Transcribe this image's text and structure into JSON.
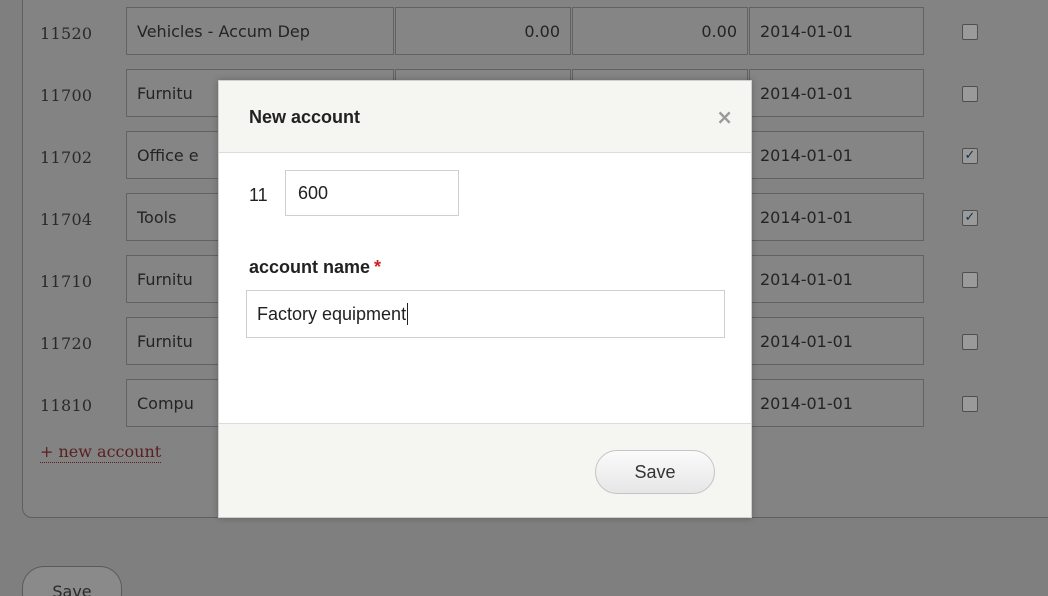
{
  "table": {
    "rows": [
      {
        "code": "11520",
        "name": "Vehicles - Accum Dep",
        "debit": "0.00",
        "credit": "0.00",
        "date": "2014-01-01",
        "checked": false
      },
      {
        "code": "11700",
        "name": "Furnitu",
        "debit": "",
        "credit": "",
        "date": "2014-01-01",
        "checked": false
      },
      {
        "code": "11702",
        "name": "Office e",
        "debit": "",
        "credit": "",
        "date": "2014-01-01",
        "checked": true
      },
      {
        "code": "11704",
        "name": "Tools",
        "debit": "",
        "credit": "",
        "date": "2014-01-01",
        "checked": true
      },
      {
        "code": "11710",
        "name": "Furnitu",
        "debit": "",
        "credit": "",
        "date": "2014-01-01",
        "checked": false
      },
      {
        "code": "11720",
        "name": "Furnitu",
        "debit": "",
        "credit": "",
        "date": "2014-01-01",
        "checked": false
      },
      {
        "code": "11810",
        "name": "Compu",
        "debit": "",
        "credit": "",
        "date": "2014-01-01",
        "checked": false
      }
    ],
    "new_account_link": "+ new account"
  },
  "page": {
    "save_label": "Save"
  },
  "modal": {
    "title": "New account",
    "close_glyph": "×",
    "code_prefix": "11",
    "code_value": "600",
    "name_label": "account name",
    "required_mark": "*",
    "name_value": "Factory equipment",
    "save_label": "Save"
  }
}
